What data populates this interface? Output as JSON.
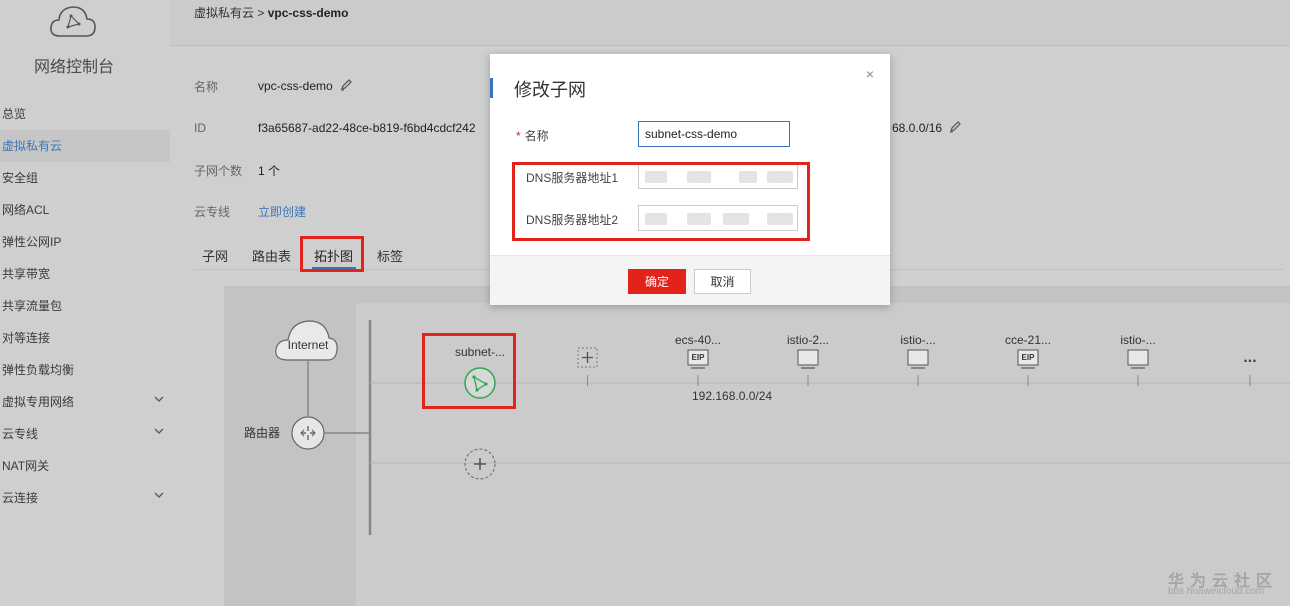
{
  "sidebar": {
    "title": "网络控制台",
    "items": [
      {
        "label": "总览",
        "active": false,
        "has_chevron": false
      },
      {
        "label": "虚拟私有云",
        "active": true,
        "has_chevron": false
      },
      {
        "label": "安全组",
        "active": false,
        "has_chevron": false
      },
      {
        "label": "网络ACL",
        "active": false,
        "has_chevron": false
      },
      {
        "label": "弹性公网IP",
        "active": false,
        "has_chevron": false
      },
      {
        "label": "共享带宽",
        "active": false,
        "has_chevron": false
      },
      {
        "label": "共享流量包",
        "active": false,
        "has_chevron": false
      },
      {
        "label": "对等连接",
        "active": false,
        "has_chevron": false
      },
      {
        "label": "弹性负载均衡",
        "active": false,
        "has_chevron": false
      },
      {
        "label": "虚拟专用网络",
        "active": false,
        "has_chevron": true
      },
      {
        "label": "云专线",
        "active": false,
        "has_chevron": true
      },
      {
        "label": "NAT网关",
        "active": false,
        "has_chevron": false
      },
      {
        "label": "云连接",
        "active": false,
        "has_chevron": true
      }
    ]
  },
  "breadcrumb": {
    "parent": "虚拟私有云",
    "separator": ">",
    "current": "vpc-css-demo"
  },
  "details": {
    "name_label": "名称",
    "name_value": "vpc-css-demo",
    "id_label": "ID",
    "id_value": "f3a65687-ad22-48ce-b819-f6bd4cdcf242",
    "cidr_value": "68.0.0/16",
    "subnet_count_label": "子网个数",
    "subnet_count_value": "1 个",
    "direct_connect_label": "云专线",
    "direct_connect_link": "立即创建"
  },
  "tabs": [
    "子网",
    "路由表",
    "拓扑图",
    "标签"
  ],
  "active_tab": "拓扑图",
  "topology": {
    "internet_label": "Internet",
    "router_label": "路由器",
    "subnet_label": "subnet-...",
    "subnet_cidr": "192.168.0.0/24",
    "instances": [
      {
        "label": "ecs-40...",
        "has_eip": true
      },
      {
        "label": "istio-2...",
        "has_eip": false
      },
      {
        "label": "istio-...",
        "has_eip": false
      },
      {
        "label": "cce-21...",
        "has_eip": true
      },
      {
        "label": "istio-...",
        "has_eip": false
      }
    ],
    "eip_text": "EIP",
    "more": "..."
  },
  "modal": {
    "title": "修改子网",
    "name_label": "名称",
    "required_mark": "*",
    "name_value": "subnet-css-demo",
    "dns1_label": "DNS服务器地址1",
    "dns2_label": "DNS服务器地址2",
    "ok_label": "确定",
    "cancel_label": "取消",
    "close_glyph": "×"
  },
  "watermark": {
    "title": "华为云社区",
    "url": "bbs.huaweicloud.com"
  },
  "colors": {
    "accent": "#3d76b8",
    "danger": "#e2231a",
    "success": "#2fa84f"
  }
}
